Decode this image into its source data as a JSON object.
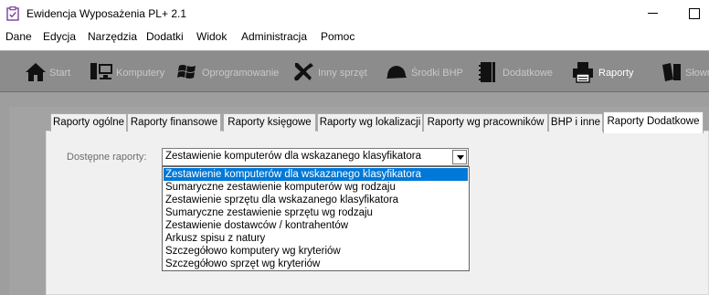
{
  "window": {
    "title": "Ewidencja Wyposażenia PL+ 2.1"
  },
  "menu": [
    "Dane",
    "Edycja",
    "Narzędzia",
    "Dodatki",
    "Widok",
    "Administracja",
    "Pomoc"
  ],
  "toolbar": [
    {
      "label": "Start",
      "icon": "home-icon"
    },
    {
      "label": "Komputery",
      "icon": "computer-icon"
    },
    {
      "label": "Oprogramowanie",
      "icon": "windows-logo-icon"
    },
    {
      "label": "Inny sprzęt",
      "icon": "tools-icon"
    },
    {
      "label": "Środki BHP",
      "icon": "helmet-icon"
    },
    {
      "label": "Dodatkowe",
      "icon": "notebook-icon"
    },
    {
      "label": "Raporty",
      "icon": "printer-icon",
      "active": true
    },
    {
      "label": "Słowniki",
      "icon": "books-icon"
    }
  ],
  "tabs": [
    "Raporty ogólne",
    "Raporty finansowe",
    "Raporty księgowe",
    "Raporty wg lokalizacji",
    "Raporty wg pracowników",
    "BHP i inne",
    "Raporty Dodatkowe"
  ],
  "active_tab": "Raporty Dodatkowe",
  "reports": {
    "label": "Dostępne raporty:",
    "selected": "Zestawienie komputerów dla wskazanego klasyfikatora",
    "options": [
      "Zestawienie komputerów dla wskazanego klasyfikatora",
      "Sumaryczne zestawienie komputerów wg rodzaju",
      "Zestawienie sprzętu dla wskazanego klasyfikatora",
      "Sumaryczne zestawienie sprzętu wg rodzaju",
      "Zestawienie dostawców / kontrahentów",
      "Arkusz spisu z natury",
      "Szczegółowo komputery wg kryteriów",
      "Szczegółowo sprzęt wg kryteriów"
    ]
  },
  "colors": {
    "selection": "#0078d7",
    "toolbar_bg": "#8c8c8c",
    "workspace_bg": "#9e9e9e"
  }
}
